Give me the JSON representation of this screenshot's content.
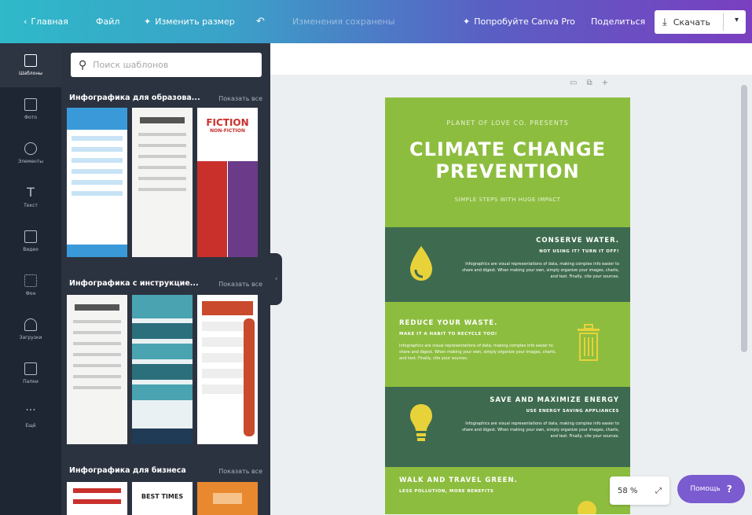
{
  "colors": {
    "brand_teal": "#2fb9c9",
    "brand_purple": "#7a3fc0",
    "sidebar_dark": "#1f2633",
    "panel_dark": "#2c3340",
    "doc_green": "#8dbd3f",
    "doc_dark_green": "#3e6b4f",
    "help_purple": "#7b5bd0"
  },
  "topbar": {
    "home": "Главная",
    "file": "Файл",
    "resize": "Изменить размер",
    "undo_icon": "undo-icon",
    "doc_name": "Изменения сохранены",
    "try_pro": "Попробуйте Canva Pro",
    "share": "Поделиться",
    "download": "Скачать"
  },
  "leftnav": {
    "items": [
      {
        "label": "Шаблоны",
        "icon": "templates-icon"
      },
      {
        "label": "Фото",
        "icon": "photos-icon"
      },
      {
        "label": "Элементы",
        "icon": "elements-icon"
      },
      {
        "label": "Текст",
        "icon": "text-icon"
      },
      {
        "label": "Видео",
        "icon": "video-icon"
      },
      {
        "label": "Фон",
        "icon": "background-icon"
      },
      {
        "label": "Загрузки",
        "icon": "uploads-icon"
      },
      {
        "label": "Папки",
        "icon": "folders-icon"
      },
      {
        "label": "Ещё",
        "icon": "more-icon"
      }
    ]
  },
  "panel": {
    "search_placeholder": "Поиск шаблонов",
    "sections": [
      {
        "title": "Инфографика для образова...",
        "link": "Показать все"
      },
      {
        "title": "Инфографика с инструкцие...",
        "link": "Показать все"
      },
      {
        "title": "Инфографика для бизнеса",
        "link": "Показать все"
      }
    ],
    "thumb_texts": {
      "fiction_1": "FICTION",
      "fiction_2": "NON-FICTION",
      "best_times": "BEST TIMES"
    }
  },
  "document": {
    "kicker": "PLANET OF LOVE CO. PRESENTS",
    "title_line1": "CLIMATE CHANGE",
    "title_line2": "PREVENTION",
    "subtitle": "SIMPLE STEPS WITH HUGE IMPACT",
    "blocks": [
      {
        "title": "CONSERVE WATER.",
        "sub": "NOT USING IT? TURN IT OFF!",
        "body": "Infographics are visual representations of data, making complex info easier to share and digest. When making your own, simply organize your images, charts, and text. Finally, cite your sources."
      },
      {
        "title": "REDUCE YOUR WASTE.",
        "sub": "MAKE IT A HABIT TO RECYCLE TOO!",
        "body": "Infographics are visual representations of data, making complex info easier to share and digest. When making your own, simply organize your images, charts, and text. Finally, cite your sources."
      },
      {
        "title": "SAVE AND MAXIMIZE ENERGY",
        "sub": "USE ENERGY SAVING APPLIANCES",
        "body": "Infographics are visual representations of data, making complex info easier to share and digest. When making your own, simply organize your images, charts, and text. Finally, cite your sources."
      },
      {
        "title": "WALK AND TRAVEL GREEN.",
        "sub": "LESS POLLUTION, MORE BENEFITS",
        "body": ""
      }
    ]
  },
  "zoom": {
    "value": "58 %"
  },
  "help": {
    "label": "Помощь",
    "icon": "?"
  }
}
